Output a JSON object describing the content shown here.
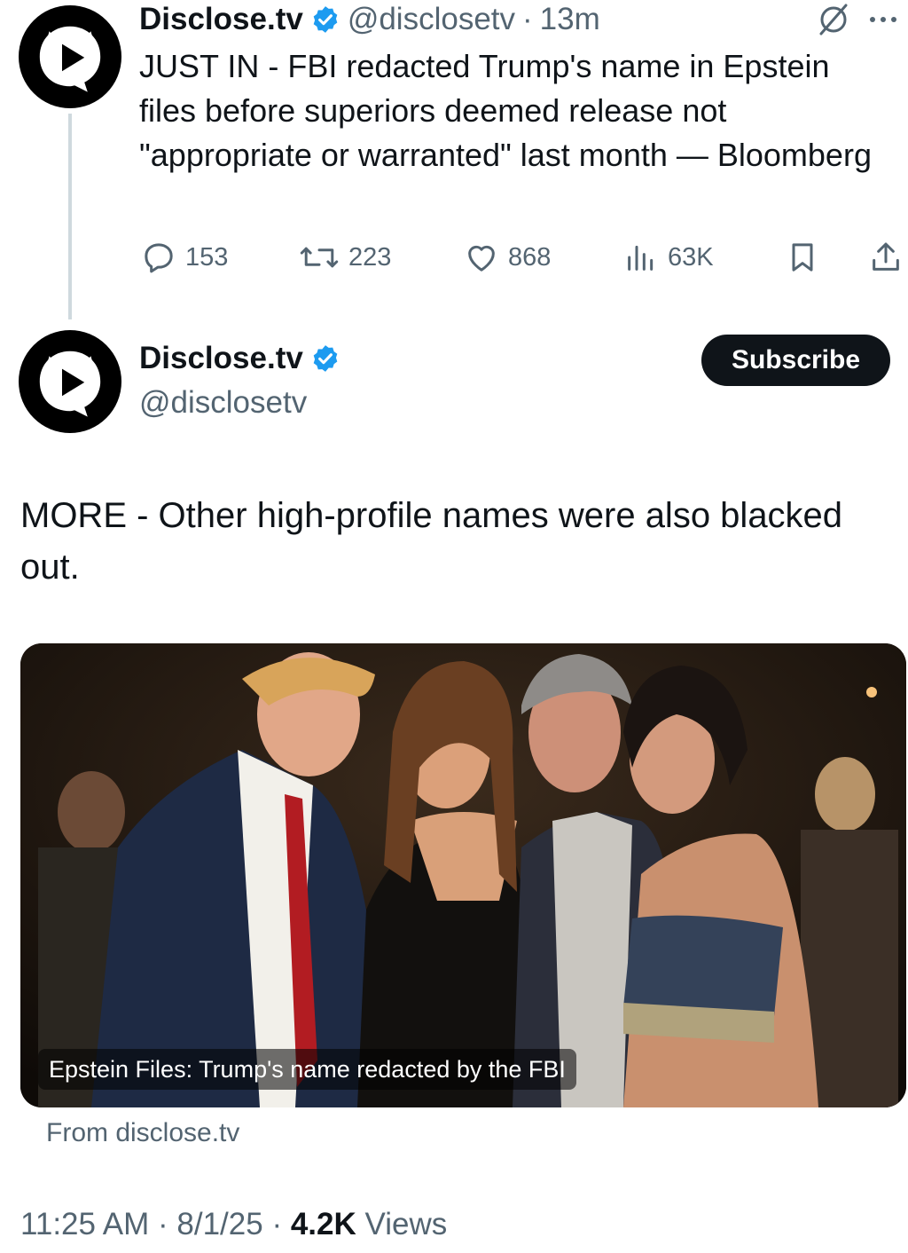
{
  "tweet1": {
    "name": "Disclose.tv",
    "handle": "@disclosetv",
    "separator": "·",
    "time_ago": "13m",
    "text": "JUST IN - FBI redacted Trump's name in Epstein files before superiors deemed release not \"appropriate or warranted\" last month — Bloomberg",
    "replies": "153",
    "reposts": "223",
    "likes": "868",
    "views": "63K",
    "icons": [
      "grok-icon",
      "more-icon",
      "reply-icon",
      "repost-icon",
      "like-icon",
      "views-icon",
      "bookmark-icon",
      "share-icon"
    ]
  },
  "tweet2": {
    "name": "Disclose.tv",
    "handle": "@disclosetv",
    "subscribe_label": "Subscribe",
    "text": "MORE - Other high-profile names were also blacked out.",
    "card": {
      "caption": "Epstein Files: Trump's name redacted by the FBI",
      "source": "From disclose.tv"
    },
    "time": "11:25 AM",
    "date": "8/1/25",
    "separator": "·",
    "views_count": "4.2K",
    "views_label": "Views"
  },
  "colors": {
    "text": "#0f1419",
    "secondary": "#536471",
    "verified": "#1d9bf0",
    "thread_line": "#cfd9de"
  }
}
